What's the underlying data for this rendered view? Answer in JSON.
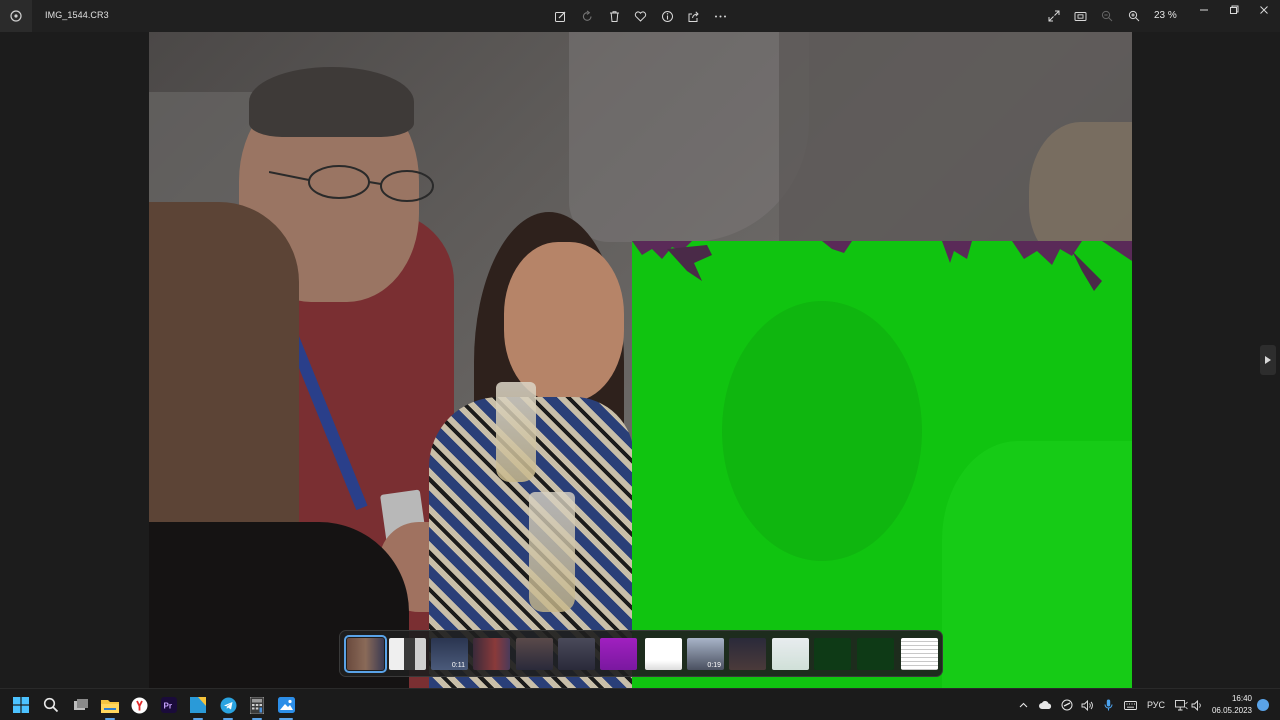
{
  "window": {
    "file_name": "IMG_1544.CR3",
    "zoom_level": "23 %"
  },
  "toolbar": {
    "icons": [
      "edit-icon",
      "rotate-icon",
      "delete-icon",
      "favorite-icon",
      "info-icon",
      "share-icon",
      "more-icon"
    ],
    "right_icons": [
      "fullscreen-icon",
      "fit-to-window-icon",
      "zoom-out-icon",
      "zoom-in-icon"
    ]
  },
  "photo": {
    "overlay_color": "#10c410"
  },
  "filmstrip": {
    "thumbnails": [
      {
        "name": "thumb-1",
        "duration": "",
        "selected": true
      },
      {
        "name": "thumb-2",
        "duration": "",
        "selected": false
      },
      {
        "name": "thumb-3",
        "duration": "0:11",
        "selected": false
      },
      {
        "name": "thumb-4",
        "duration": "",
        "selected": false
      },
      {
        "name": "thumb-5",
        "duration": "",
        "selected": false
      },
      {
        "name": "thumb-6",
        "duration": "",
        "selected": false
      },
      {
        "name": "thumb-7",
        "duration": "",
        "selected": false
      },
      {
        "name": "thumb-8",
        "duration": "",
        "selected": false
      },
      {
        "name": "thumb-9",
        "duration": "0:19",
        "selected": false
      },
      {
        "name": "thumb-10",
        "duration": "",
        "selected": false
      },
      {
        "name": "thumb-11",
        "duration": "",
        "selected": false
      },
      {
        "name": "thumb-12",
        "duration": "",
        "selected": false
      },
      {
        "name": "thumb-13",
        "duration": "",
        "selected": false
      },
      {
        "name": "thumb-14",
        "duration": "",
        "selected": false
      }
    ]
  },
  "taskbar": {
    "apps": [
      "windows-start-icon",
      "search-icon",
      "task-view-icon",
      "file-explorer-icon",
      "yandex-browser-icon",
      "premiere-pro-icon",
      "app-icon",
      "telegram-icon",
      "calculator-icon",
      "photos-icon"
    ],
    "language": "РУС",
    "time": "16:40",
    "date": "06.05.2023"
  },
  "colors": {
    "accent": "#5aa3e8",
    "background": "#1c1c1c",
    "titlebar": "#202020"
  }
}
